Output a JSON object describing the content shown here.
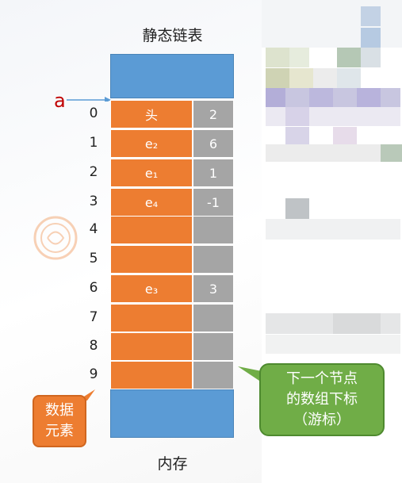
{
  "title": "静态链表",
  "pointer_label": "a",
  "rows": [
    {
      "index": "0",
      "data": "头",
      "next": "2"
    },
    {
      "index": "1",
      "data": "e₂",
      "next": "6"
    },
    {
      "index": "2",
      "data": "e₁",
      "next": "1"
    },
    {
      "index": "3",
      "data": "e₄",
      "next": "-1"
    },
    {
      "index": "4",
      "data": "",
      "next": ""
    },
    {
      "index": "5",
      "data": "",
      "next": ""
    },
    {
      "index": "6",
      "data": "e₃",
      "next": "3"
    },
    {
      "index": "7",
      "data": "",
      "next": ""
    },
    {
      "index": "8",
      "data": "",
      "next": ""
    },
    {
      "index": "9",
      "data": "",
      "next": ""
    }
  ],
  "callout_data": {
    "line1": "数据",
    "line2": "元素"
  },
  "callout_next": {
    "line1": "下一个节点",
    "line2": "的数组下标",
    "line3": "（游标）"
  },
  "bottom_label": "内存",
  "colors": {
    "data_cell": "#ed7d31",
    "next_cell": "#a5a5a5",
    "memory_block": "#5b9bd5",
    "callout_green": "#70ad47",
    "pointer_red": "#c00000"
  }
}
